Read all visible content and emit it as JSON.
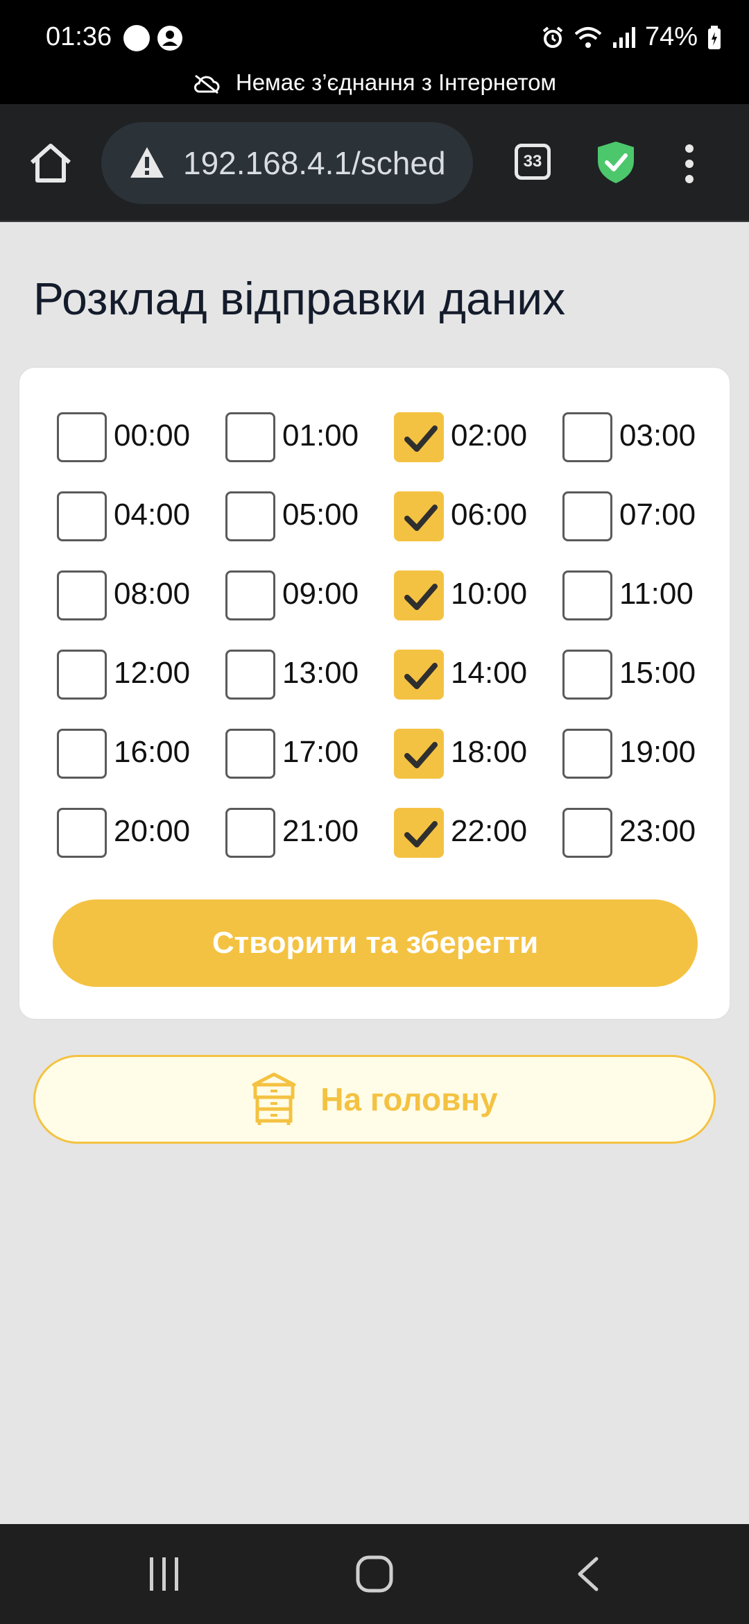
{
  "status_bar": {
    "time": "01:36",
    "battery": "74%",
    "icons": [
      "app-badge-icon",
      "account-icon",
      "alarm-icon",
      "wifi-icon",
      "signal-icon",
      "battery-icon"
    ],
    "offline_notice": "Немає з’єднання з Інтернетом"
  },
  "browser": {
    "url": "192.168.4.1/sched",
    "tab_count": "33",
    "icons": [
      "home-icon",
      "warning-icon",
      "shield-check-icon",
      "more-vert-icon"
    ]
  },
  "page": {
    "title": "Розклад відправки даних",
    "slots": [
      {
        "label": "00:00",
        "checked": false
      },
      {
        "label": "01:00",
        "checked": false
      },
      {
        "label": "02:00",
        "checked": true
      },
      {
        "label": "03:00",
        "checked": false
      },
      {
        "label": "04:00",
        "checked": false
      },
      {
        "label": "05:00",
        "checked": false
      },
      {
        "label": "06:00",
        "checked": true
      },
      {
        "label": "07:00",
        "checked": false
      },
      {
        "label": "08:00",
        "checked": false
      },
      {
        "label": "09:00",
        "checked": false
      },
      {
        "label": "10:00",
        "checked": true
      },
      {
        "label": "11:00",
        "checked": false
      },
      {
        "label": "12:00",
        "checked": false
      },
      {
        "label": "13:00",
        "checked": false
      },
      {
        "label": "14:00",
        "checked": true
      },
      {
        "label": "15:00",
        "checked": false
      },
      {
        "label": "16:00",
        "checked": false
      },
      {
        "label": "17:00",
        "checked": false
      },
      {
        "label": "18:00",
        "checked": true
      },
      {
        "label": "19:00",
        "checked": false
      },
      {
        "label": "20:00",
        "checked": false
      },
      {
        "label": "21:00",
        "checked": false
      },
      {
        "label": "22:00",
        "checked": true
      },
      {
        "label": "23:00",
        "checked": false
      }
    ],
    "save_label": "Створити та зберегти",
    "home_label": "На головну"
  },
  "colors": {
    "accent": "#f4c242",
    "home_button_bg": "#fffde8",
    "page_bg": "#e5e5e5"
  }
}
